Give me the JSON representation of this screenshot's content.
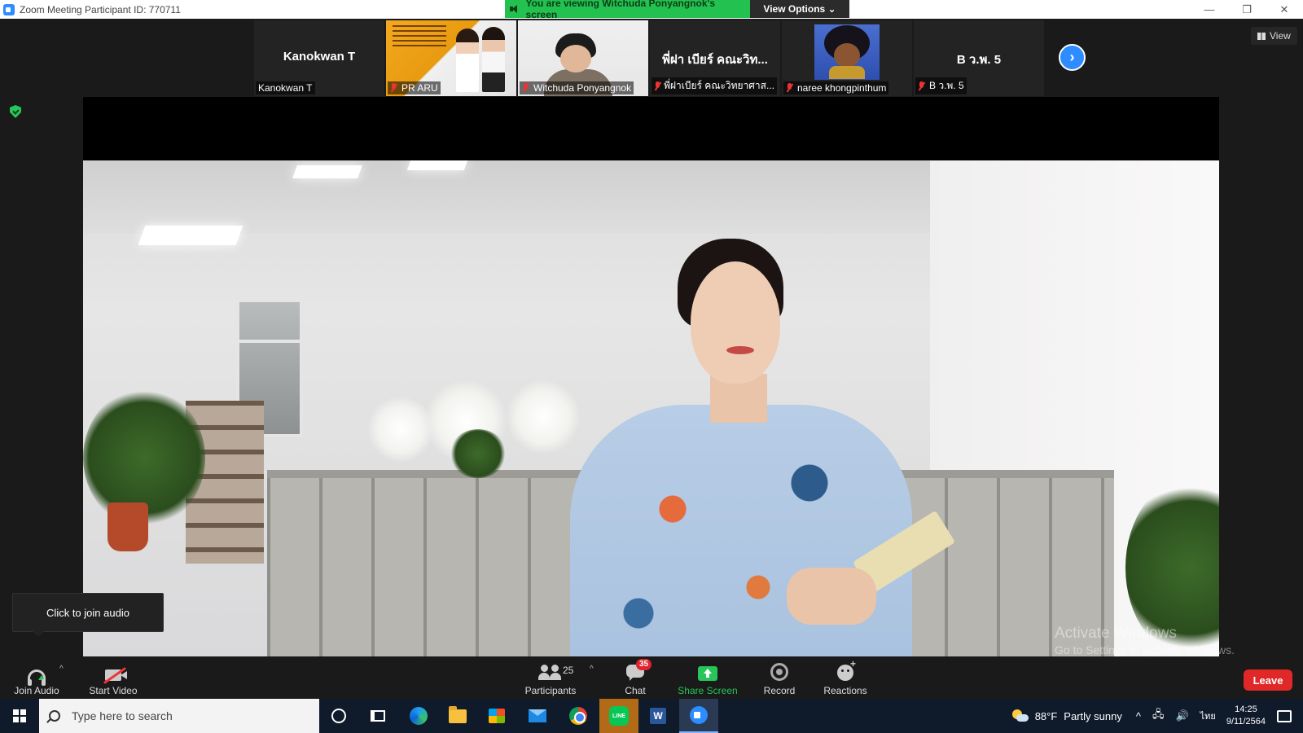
{
  "window": {
    "title": "Zoom Meeting Participant ID: 770711",
    "controls": {
      "minimize": "—",
      "restore": "❐",
      "close": "✕"
    }
  },
  "share_banner": {
    "message": "You are viewing Witchuda Ponyangnok's screen",
    "view_options": "View Options ⌄"
  },
  "gallery": {
    "tiles": [
      {
        "big_name": "Kanokwan T",
        "label": "Kanokwan T",
        "muted": false
      },
      {
        "big_name": "",
        "label": "PR ARU",
        "muted": true
      },
      {
        "big_name": "",
        "label": "Witchuda Ponyangnok",
        "muted": true
      },
      {
        "big_name": "พี่ฝา เบียร์ คณะวิท...",
        "label": "พี่ฝาเบียร์ คณะวิทยาศาส...",
        "muted": true
      },
      {
        "big_name": "",
        "label": "naree khongpinthum",
        "muted": true
      },
      {
        "big_name": "B ว.พ. 5",
        "label": "B ว.พ. 5",
        "muted": true
      }
    ],
    "next_arrow": "›",
    "view_button": "View"
  },
  "audio_tooltip": "Click to join audio",
  "watermark": {
    "line1": "Activate Windows",
    "line2": "Go to Settings to activate Windows."
  },
  "toolbar": {
    "join_audio": "Join Audio",
    "start_video": "Start Video",
    "participants": "Participants",
    "participants_count": "25",
    "chat": "Chat",
    "chat_badge": "35",
    "share_screen": "Share Screen",
    "record": "Record",
    "reactions": "Reactions",
    "leave": "Leave",
    "caret": "^"
  },
  "taskbar": {
    "search_placeholder": "Type here to search",
    "weather_temp": "88°F",
    "weather_desc": "Partly sunny",
    "tray_up": "^",
    "tray_network": "🖧",
    "tray_volume": "🔊",
    "language": "ไทย",
    "time": "14:25",
    "date": "9/11/2564",
    "line_label": "LINE",
    "word_label": "W"
  },
  "colors": {
    "accent": "#2d8cff",
    "share_green": "#23c14f",
    "leave_red": "#e02828",
    "chat_badge": "#e0242f"
  }
}
